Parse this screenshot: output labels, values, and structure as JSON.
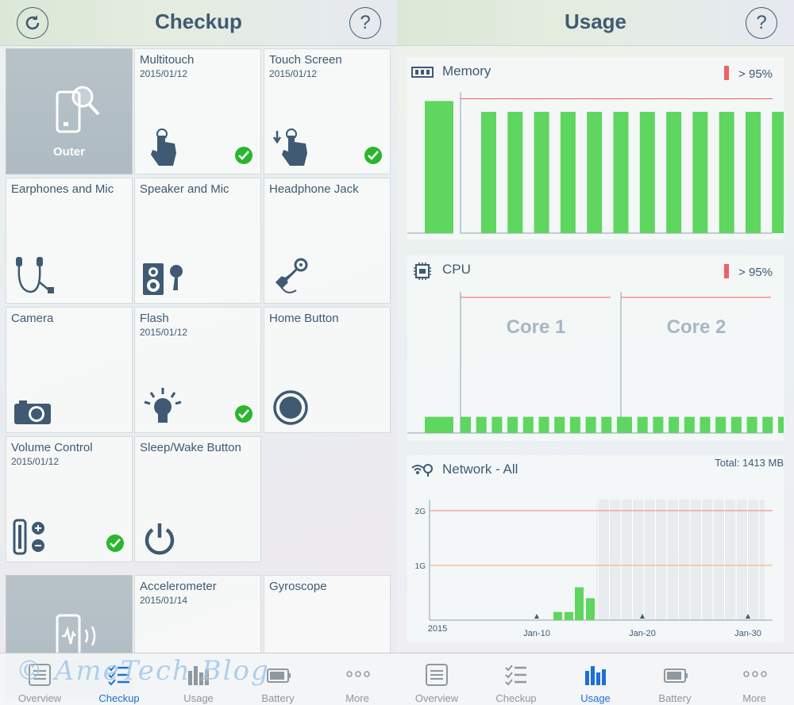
{
  "checkup": {
    "title": "Checkup",
    "tiles": [
      {
        "name": "Outer",
        "date": ""
      },
      {
        "name": "Multitouch",
        "date": "2015/01/12"
      },
      {
        "name": "Touch Screen",
        "date": "2015/01/12"
      },
      {
        "name": "Earphones and Mic",
        "date": ""
      },
      {
        "name": "Speaker and Mic",
        "date": ""
      },
      {
        "name": "Headphone Jack",
        "date": ""
      },
      {
        "name": "Camera",
        "date": ""
      },
      {
        "name": "Flash",
        "date": "2015/01/12"
      },
      {
        "name": "Home Button",
        "date": ""
      },
      {
        "name": "Volume Control",
        "date": "2015/01/12"
      },
      {
        "name": "Sleep/Wake Button",
        "date": ""
      },
      {
        "name": "Accelerometer",
        "date": "2015/01/14"
      },
      {
        "name": "Gyroscope",
        "date": ""
      }
    ],
    "help": "?"
  },
  "usage": {
    "title": "Usage",
    "help": "?",
    "memory": {
      "label": "Memory",
      "threshold": "> 95%"
    },
    "cpu": {
      "label": "CPU",
      "threshold": "> 95%",
      "core1": "Core 1",
      "core2": "Core 2"
    },
    "network": {
      "label": "Network - All",
      "total": "Total: 1413 MB",
      "y_labels": [
        "2G",
        "1G"
      ],
      "x_labels": [
        "2015",
        "Jan-10",
        "Jan-20",
        "Jan-30"
      ]
    }
  },
  "tabs": [
    "Overview",
    "Checkup",
    "Usage",
    "Battery",
    "More"
  ],
  "left_active_tab": "Checkup",
  "right_active_tab": "Usage",
  "watermark": "© AmeTech Blog",
  "colors": {
    "accent": "#1e6fd9",
    "bar_green": "#5fd65f",
    "check_green": "#2ab62d",
    "threshold_red": "#f06060"
  },
  "chart_data": [
    {
      "type": "bar",
      "title": "Memory",
      "values": [
        98,
        90,
        90,
        90,
        90,
        90,
        90,
        90,
        90,
        90,
        90,
        90,
        90
      ],
      "threshold": 95
    },
    {
      "type": "bar",
      "title": "CPU Core 1",
      "values": [
        10,
        10,
        10,
        10,
        10,
        10,
        10,
        10,
        10,
        10,
        10
      ],
      "threshold": 95
    },
    {
      "type": "bar",
      "title": "CPU Core 2",
      "values": [
        10,
        10,
        10,
        10,
        10,
        10,
        10,
        10,
        10,
        10,
        10
      ],
      "threshold": 95
    },
    {
      "type": "bar",
      "title": "Network - All",
      "ylabel": "",
      "ylim": [
        0,
        2.2
      ],
      "x": [
        "Jan-14",
        "Jan-15",
        "Jan-16",
        "Jan-17"
      ],
      "values": [
        0.15,
        0.15,
        0.6,
        0.4
      ]
    }
  ]
}
